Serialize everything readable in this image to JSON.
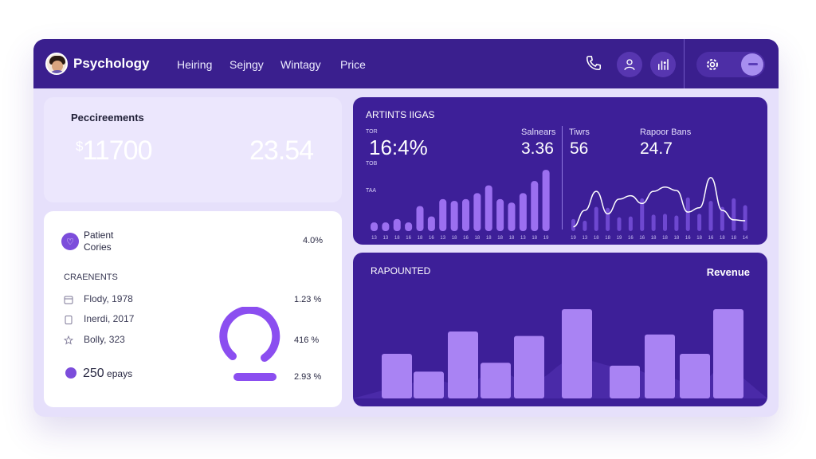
{
  "header": {
    "brand": "Psychology",
    "nav": [
      "Heiring",
      "Sejngy",
      "Wintagy",
      "Price"
    ]
  },
  "card_summary": {
    "title": "Peccireements",
    "value_left_symbol": "$",
    "value_left": "11700",
    "value_right": "23.54"
  },
  "card_patients": {
    "patient_label_1": "Patient",
    "patient_label_2": "Cories",
    "patient_percent": "4.0%",
    "section_title": "CRAENENTS",
    "rows": [
      {
        "icon": "calendar-icon",
        "text": "Flody, 1978",
        "percent": "1.23 %"
      },
      {
        "icon": "clipboard-icon",
        "text": "Inerdi, 2017",
        "percent": ""
      },
      {
        "icon": "star-icon",
        "text": "Bolly, 323",
        "percent": "416 %"
      }
    ],
    "footer_count": "250",
    "footer_label": "epays",
    "footer_percent": "2.93 %"
  },
  "card_stats": {
    "title": "ARTINTS IIGAS",
    "small_top": "TOR",
    "small_mid": "TOB",
    "small_low": "TAA",
    "big_value": "16:4%",
    "labels": [
      "Salnears",
      "Tiwrs",
      "Rapoor Bans"
    ],
    "values": [
      "3.36",
      "56",
      "24.7"
    ],
    "bar_color": "#9b6ff0",
    "line_color": "#ffffff"
  },
  "card_revenue": {
    "title": "RAPOUNTED",
    "label": "Revenue",
    "bar_color": "#a983f3"
  },
  "chart_data": [
    {
      "type": "bar",
      "values": [
        1,
        1,
        1.4,
        1,
        2.9,
        1.7,
        3.7,
        3.5,
        3.7,
        4.4,
        5.3,
        3.7,
        3.3,
        4.4,
        5.8,
        7.1
      ],
      "tick_labels": [
        "13",
        "13",
        "18",
        "16",
        "18",
        "16",
        "13",
        "18",
        "16",
        "18",
        "18",
        "18",
        "18",
        "13",
        "18",
        "19"
      ]
    },
    {
      "type": "line",
      "values": [
        0.5,
        2.4,
        4.6,
        2.0,
        3.7,
        4.1,
        3.2,
        4.6,
        5.1,
        4.7,
        2.2,
        2.7,
        6.2,
        2.4,
        1.3,
        1.2
      ],
      "bar_values": [
        1.4,
        1.2,
        2.8,
        2.7,
        1.6,
        1.7,
        3.8,
        1.9,
        2.0,
        1.8,
        3.9,
        2.0,
        3.5,
        2.8,
        3.8,
        3.0
      ],
      "tick_labels": [
        "19",
        "13",
        "18",
        "18",
        "19",
        "16",
        "16",
        "18",
        "18",
        "18",
        "16",
        "18",
        "16",
        "18",
        "18",
        "14"
      ]
    },
    {
      "type": "bar",
      "title": "Revenue",
      "values": [
        3.0,
        1.8,
        4.5,
        2.4,
        4.2,
        6.0,
        2.2,
        4.3,
        3.0,
        6.0
      ],
      "background_wave": [
        0.8,
        1.3,
        0.9,
        1.8,
        1.2,
        2.6,
        2.1,
        1.5,
        1.0,
        2.2
      ]
    }
  ]
}
